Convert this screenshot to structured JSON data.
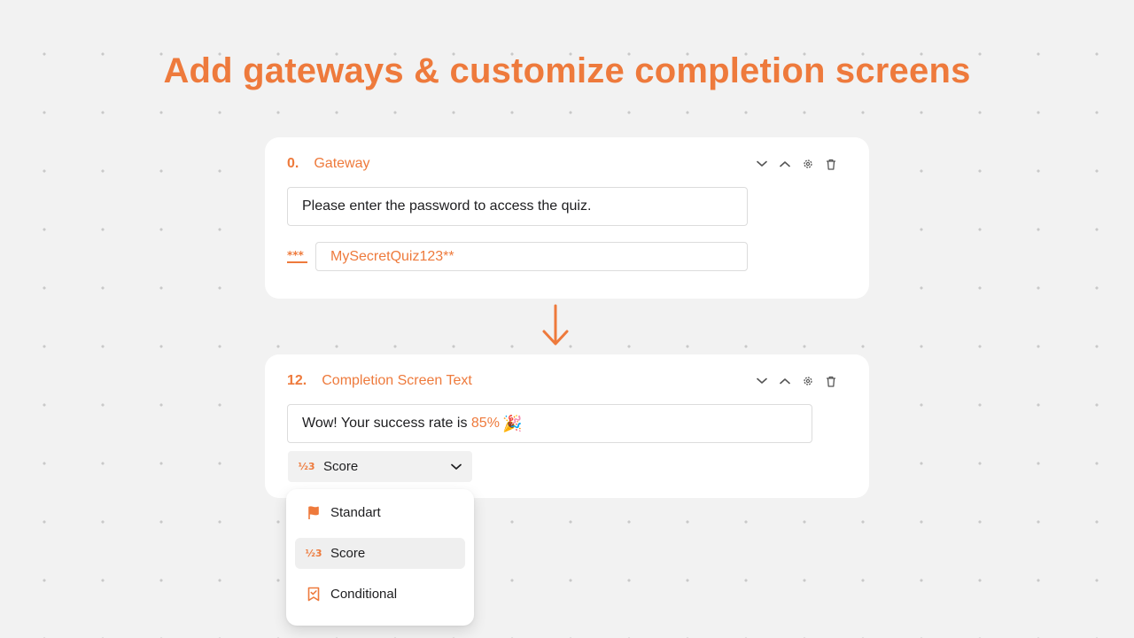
{
  "headline": "Add gateways & customize completion screens",
  "colors": {
    "accent": "#ee7a3c",
    "background": "#f2f2f2",
    "card": "#ffffff",
    "icon_gray": "#555555"
  },
  "gateway_card": {
    "number": "0.",
    "title": "Gateway",
    "prompt_text": "Please enter the password to access the quiz.",
    "password_icon": "password-asterisk-icon",
    "password_value": "MySecretQuiz123**"
  },
  "completion_card": {
    "number": "12.",
    "title": "Completion Screen Text",
    "message_prefix": "Wow! Your success rate is ",
    "message_highlight": "85%",
    "message_emoji": "🎉",
    "type_select": {
      "selected_label": "Score",
      "icon": "fraction-icon"
    }
  },
  "toolbar_icons": [
    "chevron-down-icon",
    "chevron-up-icon",
    "gear-icon",
    "trash-icon"
  ],
  "dropdown": {
    "items": [
      {
        "label": "Standart",
        "icon": "flag-icon",
        "selected": false
      },
      {
        "label": "Score",
        "icon": "fraction-icon",
        "selected": true
      },
      {
        "label": "Conditional",
        "icon": "bookmark-check-icon",
        "selected": false
      }
    ]
  }
}
